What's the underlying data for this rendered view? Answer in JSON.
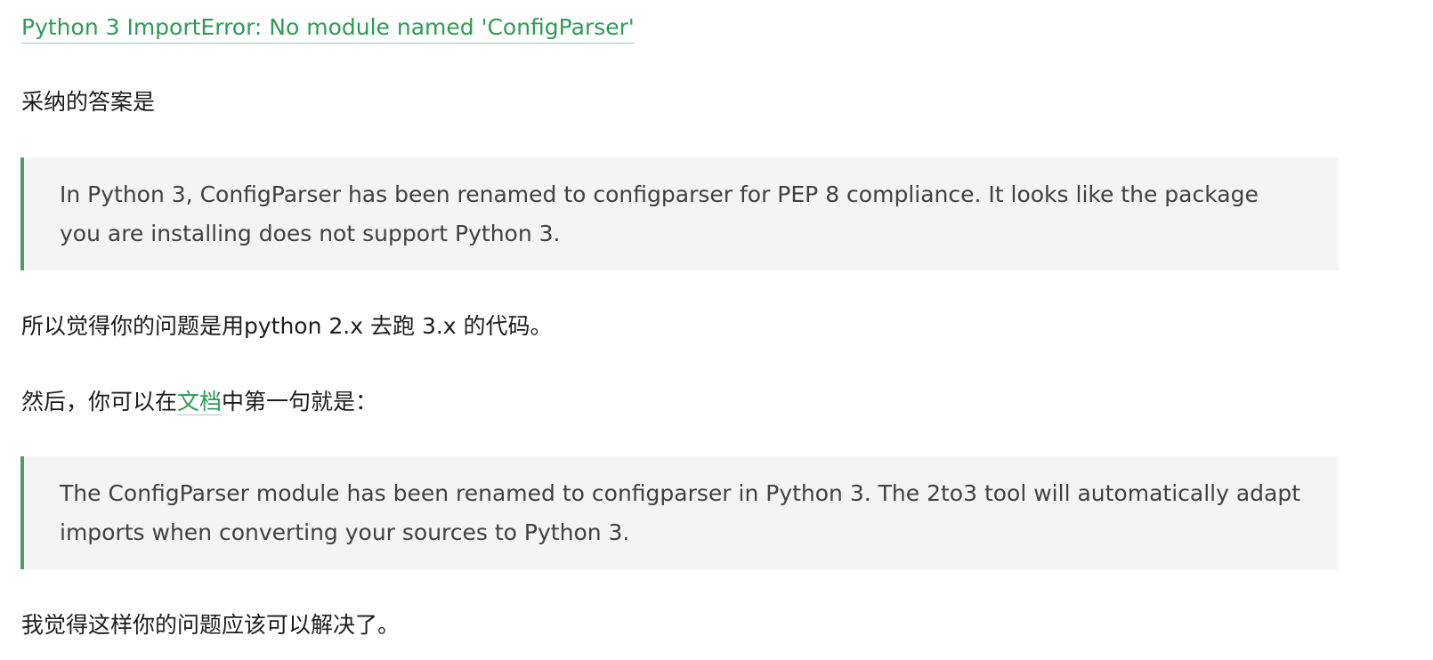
{
  "article": {
    "title_link": "Python 3 ImportError: No module named 'ConfigParser'",
    "accepted_answer_label": "采纳的答案是",
    "quote1": {
      "line1": "In Python 3, ConfigParser has been renamed to configparser for PEP 8 compliance. It looks like the package",
      "line2": "you are installing does not support Python 3."
    },
    "explanation": "所以觉得你的问题是用python 2.x 去跑 3.x 的代码。",
    "doc_sentence": {
      "prefix": "然后，你可以在",
      "link": "文档",
      "suffix": "中第一句就是："
    },
    "quote2": {
      "line1": "The ConfigParser module has been renamed to configparser in Python 3. The 2to3 tool will automatically adapt",
      "line2": "imports when converting your sources to Python 3."
    },
    "conclusion": "我觉得这样你的问题应该可以解决了。"
  },
  "colors": {
    "link": "#2f9a57",
    "quote_border": "#4f9b67",
    "quote_background": "#f4f4f4"
  }
}
